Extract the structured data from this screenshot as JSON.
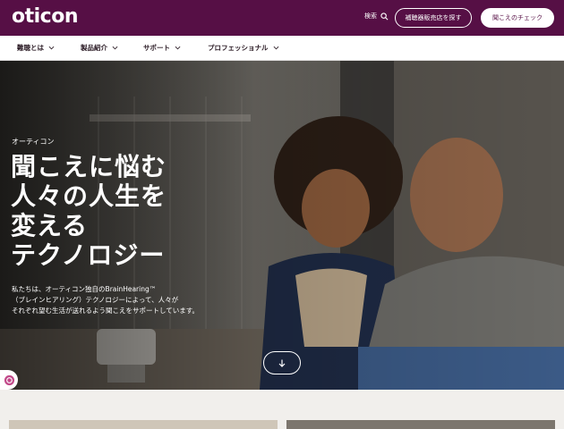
{
  "header": {
    "logo": "oticon",
    "search_label": "検索",
    "find_store_label": "補聴器販売店を探す",
    "hearing_check_label": "聞こえのチェック"
  },
  "nav": {
    "items": [
      {
        "label": "難聴とは"
      },
      {
        "label": "製品紹介"
      },
      {
        "label": "サポート"
      },
      {
        "label": "プロフェッショナル"
      }
    ]
  },
  "hero": {
    "eyebrow": "オーティコン",
    "headline_lines": [
      "聞こえに悩む",
      "人々の人生を",
      "変える",
      "テクノロジー"
    ],
    "description_lines": [
      "私たちは、オーティコン独自のBrainHearing™",
      "（ブレインヒアリング）テクノロジーによって、人々が",
      "それぞれ望む生活が送れるよう聞こえをサポートしています。"
    ]
  },
  "colors": {
    "brand": "#560f45",
    "nav_background": "#ffffff",
    "page_background": "#f1efec"
  },
  "icons": {
    "search": "search-icon",
    "chevron": "chevron-down-icon",
    "scroll": "arrow-down-icon",
    "chat": "chat-icon"
  }
}
